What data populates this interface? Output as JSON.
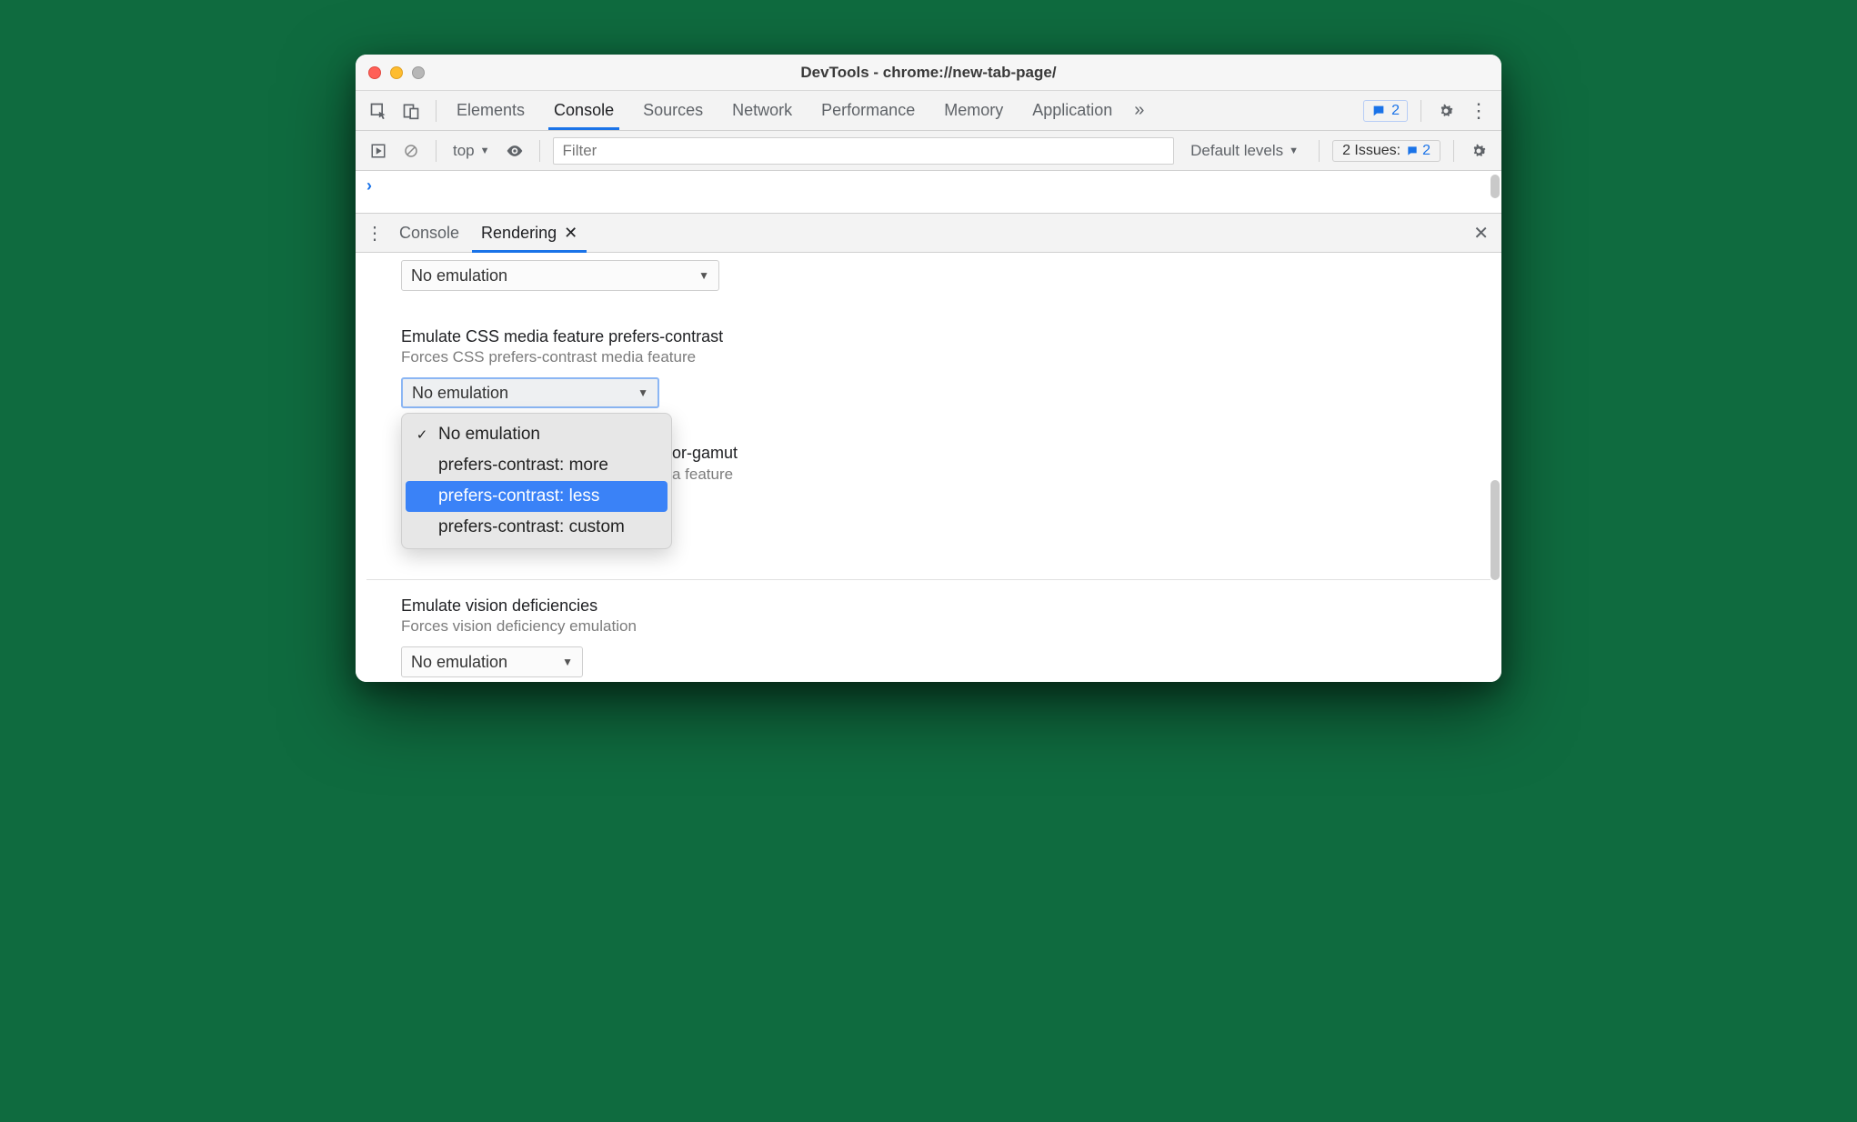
{
  "titlebar": {
    "title": "DevTools - chrome://new-tab-page/"
  },
  "tabs": [
    "Elements",
    "Console",
    "Sources",
    "Network",
    "Performance",
    "Memory",
    "Application"
  ],
  "tabs_active_index": 1,
  "topbadge_count": "2",
  "subbar": {
    "context": "top",
    "filter_placeholder": "Filter",
    "levels": "Default levels",
    "issues_label": "2 Issues:",
    "issues_count": "2"
  },
  "drawer": {
    "tabs": [
      "Console",
      "Rendering"
    ],
    "active_index": 1
  },
  "rendering": {
    "top_select_value": "No emulation",
    "contrast": {
      "title": "Emulate CSS media feature prefers-contrast",
      "desc": "Forces CSS prefers-contrast media feature",
      "select_value": "No emulation",
      "options": [
        "No emulation",
        "prefers-contrast: more",
        "prefers-contrast: less",
        "prefers-contrast: custom"
      ],
      "checked_index": 0,
      "highlight_index": 2
    },
    "gamut": {
      "title_partial": "or-gamut",
      "desc_partial": "a feature"
    },
    "vision": {
      "title": "Emulate vision deficiencies",
      "desc": "Forces vision deficiency emulation",
      "select_value": "No emulation"
    }
  }
}
